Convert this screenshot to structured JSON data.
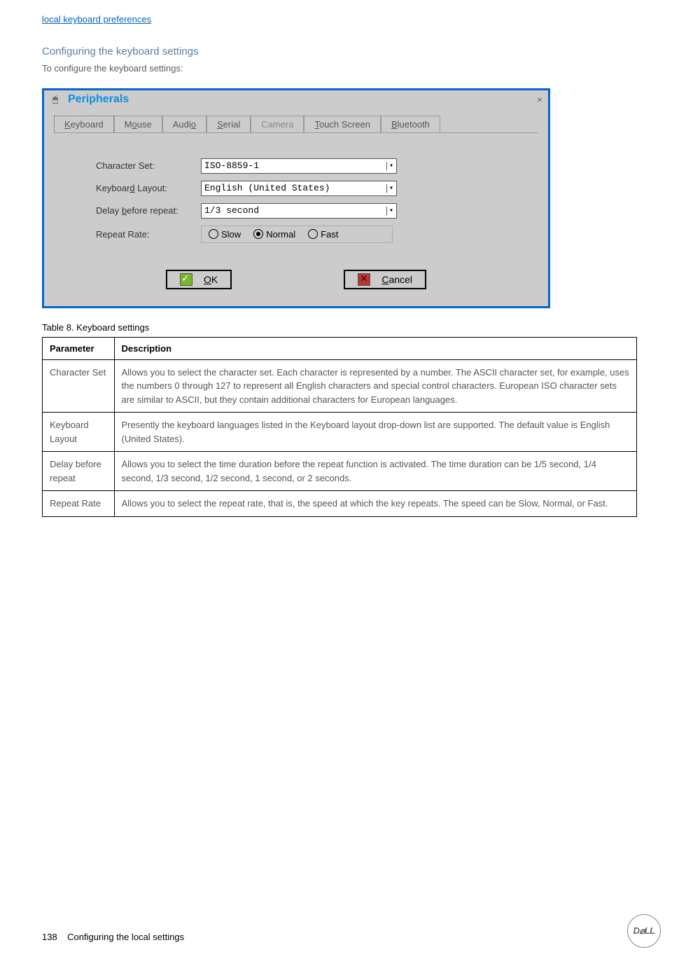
{
  "link": "local keyboard preferences",
  "heading": "Configuring the keyboard settings",
  "intro": "To configure the keyboard settings:",
  "dialog": {
    "title": "Peripherals",
    "tabs": [
      "Keyboard",
      "Mouse",
      "Audio",
      "Serial",
      "Camera",
      "Touch Screen",
      "Bluetooth"
    ],
    "labels": {
      "charset": "Character Set:",
      "layout": "Keyboard Layout:",
      "delay": "Delay before repeat:",
      "rate": "Repeat Rate:"
    },
    "values": {
      "charset": "ISO-8859-1",
      "layout": "English (United States)",
      "delay": "1/3 second"
    },
    "radios": {
      "slow": "Slow",
      "normal": "Normal",
      "fast": "Fast"
    },
    "ok": "OK",
    "cancel": "Cancel"
  },
  "tablecap": "Table 8. Keyboard settings",
  "th": {
    "p": "Parameter",
    "d": "Description"
  },
  "rows": [
    {
      "p": "Character Set",
      "d": "Allows you to select the character set. Each character is represented by a number. The ASCII character set, for example, uses the numbers 0 through 127 to represent all English characters and special control characters. European ISO character sets are similar to ASCII, but they contain additional characters for European languages."
    },
    {
      "p": "Keyboard Layout",
      "d": "Presently the keyboard languages listed in the Keyboard layout drop-down list are supported. The default value is English (United States)."
    },
    {
      "p": "Delay before repeat",
      "d": "Allows you to select the time duration before the repeat function is activated. The time duration can be 1/5 second, 1/4 second, 1/3 second, 1/2 second, 1 second, or 2 seconds."
    },
    {
      "p": "Repeat Rate",
      "d": "Allows you to select the repeat rate, that is, the speed at which the key repeats. The speed can be Slow, Normal, or Fast."
    }
  ],
  "footer": {
    "page": "138",
    "title": "Configuring the local settings"
  }
}
